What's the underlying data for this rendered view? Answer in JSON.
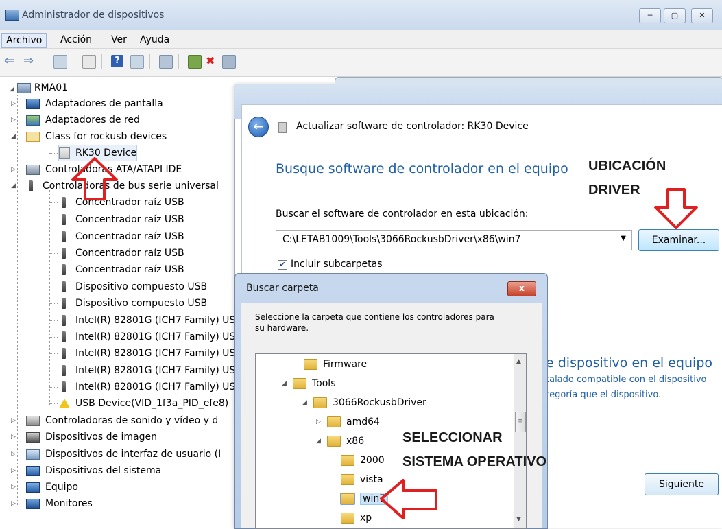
{
  "window": {
    "title": "Administrador de dispositivos",
    "menu": [
      "Archivo",
      "Acción",
      "Ver",
      "Ayuda"
    ]
  },
  "tree": {
    "root": "RMA01",
    "nodes": [
      {
        "label": "Adaptadores de pantalla"
      },
      {
        "label": "Adaptadores de red"
      },
      {
        "label": "Class for rockusb devices"
      },
      {
        "label": "RK30 Device"
      },
      {
        "label": "Controladoras ATA/ATAPI IDE"
      },
      {
        "label": "Controladoras de bus serie universal"
      },
      {
        "label": "Concentrador raíz USB"
      },
      {
        "label": "Concentrador raíz USB"
      },
      {
        "label": "Concentrador raíz USB"
      },
      {
        "label": "Concentrador raíz USB"
      },
      {
        "label": "Concentrador raíz USB"
      },
      {
        "label": "Dispositivo compuesto USB"
      },
      {
        "label": "Dispositivo compuesto USB"
      },
      {
        "label": "Intel(R) 82801G (ICH7 Family) US"
      },
      {
        "label": "Intel(R) 82801G (ICH7 Family) US"
      },
      {
        "label": "Intel(R) 82801G (ICH7 Family) US"
      },
      {
        "label": "Intel(R) 82801G (ICH7 Family) US"
      },
      {
        "label": "Intel(R) 82801G (ICH7 Family) US"
      },
      {
        "label": "USB Device(VID_1f3a_PID_efe8)"
      },
      {
        "label": "Controladoras de sonido y vídeo y d"
      },
      {
        "label": "Dispositivos de imagen"
      },
      {
        "label": "Dispositivos de interfaz de usuario (I"
      },
      {
        "label": "Dispositivos del sistema"
      },
      {
        "label": "Equipo"
      },
      {
        "label": "Monitores"
      }
    ]
  },
  "update_dialog": {
    "header": "Actualizar software de controlador: RK30 Device",
    "heading": "Busque software de controlador en el equipo",
    "location_label": "Buscar el software de controlador en esta ubicación:",
    "path_value": "C:\\LETAB1009\\Tools\\3066RockusbDriver\\x86\\win7",
    "browse_label": "Examinar...",
    "include_subfolders": "Incluir subcarpetas",
    "option2_title": "e dispositivo en el equipo",
    "option2_line1": "talado compatible con el dispositivo",
    "option2_line2": "tegoría que el dispositivo.",
    "next_label": "Siguiente"
  },
  "browse_dialog": {
    "title": "Buscar carpeta",
    "close_label": "x",
    "instruction_line1": "Seleccione la carpeta que contiene los controladores para",
    "instruction_line2": "su hardware.",
    "folders": [
      {
        "label": "Firmware"
      },
      {
        "label": "Tools"
      },
      {
        "label": "3066RockusbDriver"
      },
      {
        "label": "amd64"
      },
      {
        "label": "x86"
      },
      {
        "label": "2000"
      },
      {
        "label": "vista"
      },
      {
        "label": "win7"
      },
      {
        "label": "xp"
      }
    ]
  },
  "annotations": {
    "ubicacion_line1": "UBICACIÓN",
    "ubicacion_line2": "DRIVER",
    "seleccionar_line1": "SELECCIONAR",
    "seleccionar_line2": "SISTEMA OPERATIVO"
  },
  "colors": {
    "heading_blue": "#1f5fa8",
    "arrow_red": "#e02020",
    "selection_blue": "#cce4f7"
  }
}
